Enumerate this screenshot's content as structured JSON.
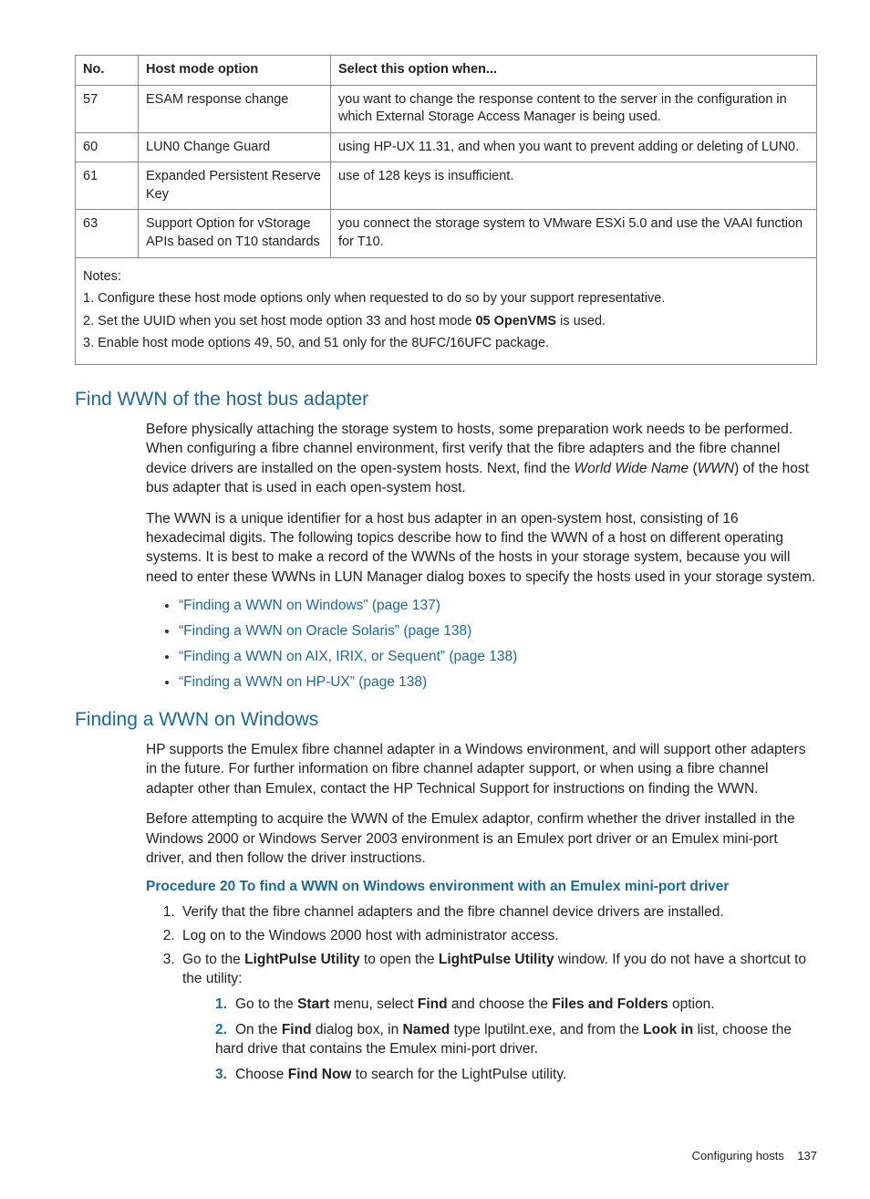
{
  "table": {
    "headers": {
      "no": "No.",
      "option": "Host mode option",
      "when": "Select this option when..."
    },
    "rows": [
      {
        "no": "57",
        "option": "ESAM response change",
        "when": "you want to change the response content to the server in the configuration in which External Storage Access Manager is being used."
      },
      {
        "no": "60",
        "option": "LUN0 Change Guard",
        "when": "using HP-UX 11.31, and when you want to prevent adding or deleting of LUN0."
      },
      {
        "no": "61",
        "option": "Expanded Persistent Reserve Key",
        "when": "use of 128 keys is insufficient."
      },
      {
        "no": "63",
        "option": "Support Option for vStorage APIs based on T10 standards",
        "when": "you connect the storage system to VMware ESXi 5.0 and use the VAAI function for T10."
      }
    ],
    "notes_title": "Notes:",
    "notes": [
      "Configure these host mode options only when requested to do so by your support representative.",
      "Set the UUID when you set host mode option 33 and host mode 05 OpenVMS is used.",
      "Enable host mode options 49, 50, and 51 only for the 8UFC/16UFC package."
    ],
    "note2_prefix": "Set the UUID when you set host mode option 33 and host mode ",
    "note2_bold": "05 OpenVMS",
    "note2_suffix": " is used."
  },
  "section1": {
    "title": "Find WWN of the host bus adapter",
    "p1_part1": "Before physically attaching the storage system to hosts, some preparation work needs to be performed. When configuring a fibre channel environment, first verify that the fibre adapters and the fibre channel device drivers are installed on the open-system hosts. Next, find the ",
    "p1_italic": "World Wide Name",
    "p1_part2": " (",
    "p1_italic2": "WWN",
    "p1_part3": ") of the host bus adapter that is used in each open-system host.",
    "p2": "The WWN is a unique identifier for a host bus adapter in an open-system host, consisting of 16 hexadecimal digits. The following topics describe how to find the WWN of a host on different operating systems. It is best to make a record of the WWNs of the hosts in your storage system, because you will need to enter these WWNs in LUN Manager dialog boxes to specify the hosts used in your storage system.",
    "links": [
      "“Finding a WWN on Windows” (page 137)",
      "“Finding a WWN on Oracle Solaris” (page 138)",
      "“Finding a WWN on AIX, IRIX, or Sequent” (page 138)",
      "“Finding a WWN on HP-UX” (page 138)"
    ]
  },
  "section2": {
    "title": "Finding a WWN on Windows",
    "p1": "HP supports the Emulex fibre channel adapter in a Windows environment, and will support other adapters in the future. For further information on fibre channel adapter support, or when using a fibre channel adapter other than Emulex, contact the HP Technical Support for instructions on finding the WWN.",
    "p2": "Before attempting to acquire the WWN of the Emulex adaptor, confirm whether the driver installed in the Windows 2000 or Windows Server 2003 environment is an Emulex port driver or an Emulex mini-port driver, and then follow the driver instructions.",
    "proc_title": "Procedure 20 To find a WWN on Windows environment with an Emulex mini-port driver",
    "steps": {
      "s1": "Verify that the fibre channel adapters and the fibre channel device drivers are installed.",
      "s2": "Log on to the Windows 2000 host with administrator access.",
      "s3_a": "Go to the ",
      "s3_b1": "LightPulse Utility",
      "s3_c": " to open the ",
      "s3_b2": "LightPulse Utility",
      "s3_d": " window. If you do not have a shortcut to the utility:",
      "sub1_a": "Go to the ",
      "sub1_b1": "Start",
      "sub1_c": " menu, select ",
      "sub1_b2": "Find",
      "sub1_d": " and choose the ",
      "sub1_b3": "Files and Folders",
      "sub1_e": " option.",
      "sub2_a": "On the ",
      "sub2_b1": "Find",
      "sub2_c": " dialog box, in ",
      "sub2_b2": "Named",
      "sub2_d": " type lputilnt.exe, and from the ",
      "sub2_b3": "Look in",
      "sub2_e": " list, choose the hard drive that contains the Emulex mini-port driver.",
      "sub3_a": "Choose ",
      "sub3_b1": "Find Now",
      "sub3_c": " to search for the LightPulse utility."
    }
  },
  "footer": {
    "text": "Configuring hosts",
    "page": "137"
  }
}
